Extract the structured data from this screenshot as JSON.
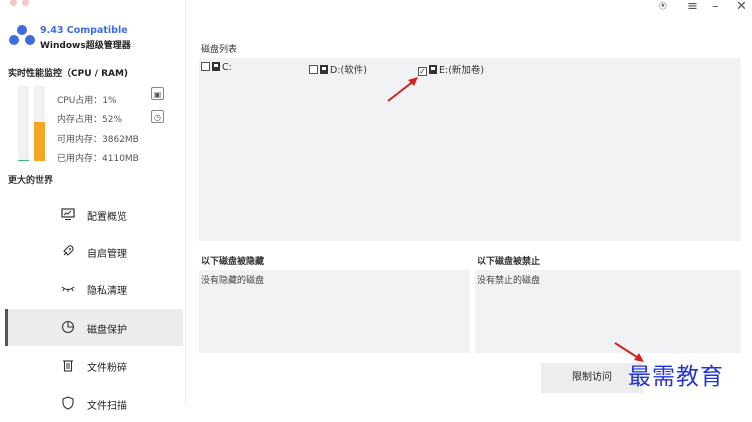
{
  "app": {
    "version": "9.43 Compatible",
    "name": "Windows超级管理器"
  },
  "monitor": {
    "title": "实时性能监控（CPU / RAM)",
    "cpu_label": "CPU占用：",
    "cpu_value": "1%",
    "mem_label": "内存占用：",
    "mem_value": "52%",
    "avail_label": "可用内存：",
    "avail_value": "3862MB",
    "used_label": "已用内存：",
    "used_value": "4110MB",
    "cpu_fraction": 0.01,
    "mem_fraction": 0.52,
    "cpu_color": "#3cb878",
    "mem_color": "#f5a623"
  },
  "section_world": "更大的世界",
  "nav": [
    {
      "label": "配置概览",
      "icon": "monitor-icon"
    },
    {
      "label": "自启管理",
      "icon": "rocket-icon"
    },
    {
      "label": "隐私清理",
      "icon": "eye-closed-icon"
    },
    {
      "label": "磁盘保护",
      "icon": "pie-chart-icon",
      "active": true
    },
    {
      "label": "文件粉碎",
      "icon": "trash-icon"
    },
    {
      "label": "文件扫描",
      "icon": "shield-icon"
    }
  ],
  "main": {
    "disk_list_title": "磁盘列表",
    "disks": [
      {
        "label": "C:",
        "checked": false
      },
      {
        "label": "D:(软件)",
        "checked": false
      },
      {
        "label": "E:(新加卷)",
        "checked": true
      }
    ],
    "hidden_title": "以下磁盘被隐藏",
    "hidden_empty": "没有隐藏的磁盘",
    "banned_title": "以下磁盘被禁止",
    "banned_empty": "没有禁止的磁盘",
    "limit_button": "限制访问"
  },
  "watermark": "最需教育",
  "colors": {
    "accent": "#3d6be0",
    "arrow": "#d42020",
    "watermark": "#2435d6"
  }
}
